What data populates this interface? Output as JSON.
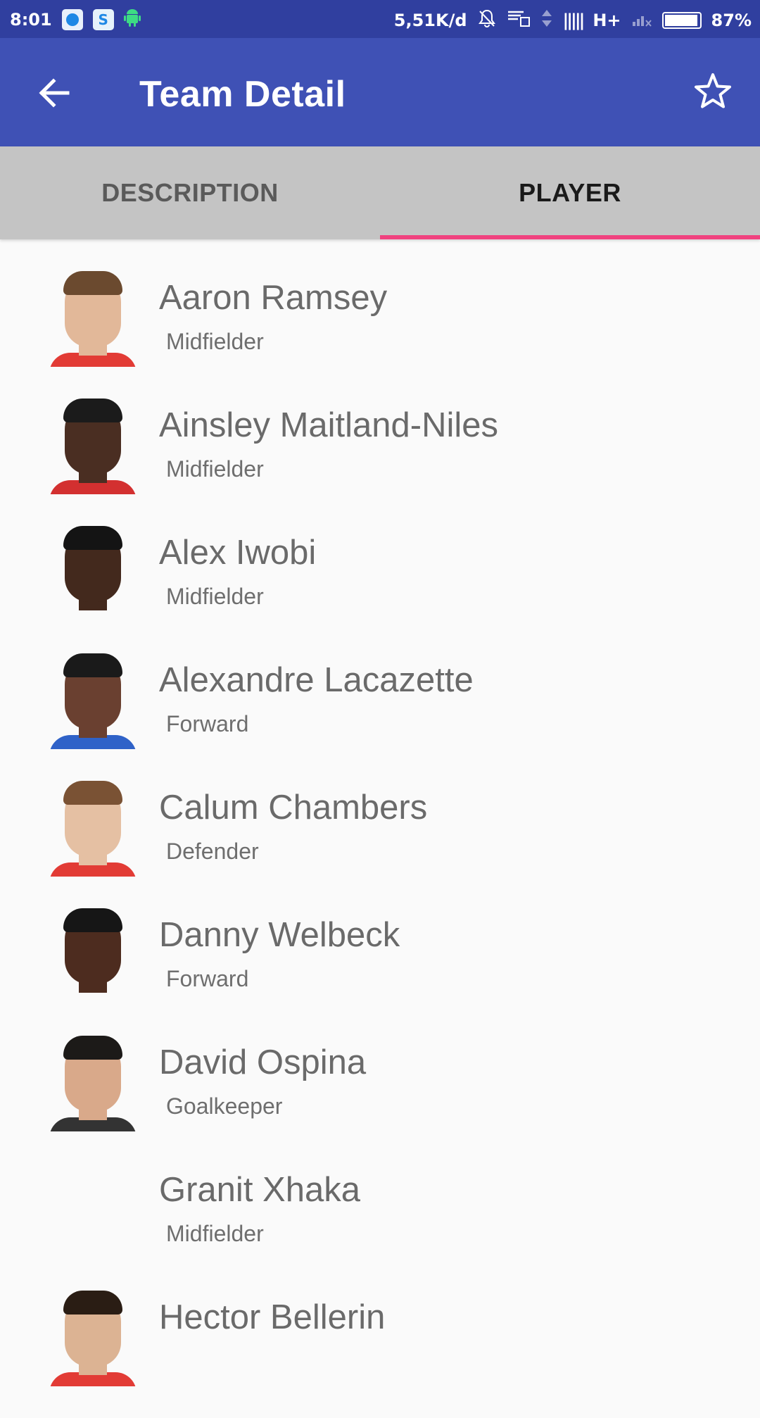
{
  "status_bar": {
    "time": "8:01",
    "net_speed": "5,51K/d",
    "network": "H+",
    "battery": "87%",
    "left_icons": [
      "browser-icon",
      "s-app-icon",
      "android-icon"
    ],
    "right_icons": [
      "notifications-off-icon",
      "wifi-icon",
      "data-arrows-icon",
      "signal-icon",
      "battery-icon"
    ]
  },
  "app_bar": {
    "title": "Team Detail",
    "back_icon": "arrow-back-icon",
    "favorite_icon": "star-outline-icon",
    "background": "#3f51b5"
  },
  "tabs": [
    {
      "label": "DESCRIPTION",
      "selected": false
    },
    {
      "label": "PLAYER",
      "selected": true
    }
  ],
  "accent_color": "#f0427f",
  "players": [
    {
      "name": "Aaron Ramsey",
      "position": "Midfielder",
      "skin": "#e2b899",
      "hair": "#6b4a2f",
      "shirt": "#e23b35"
    },
    {
      "name": "Ainsley Maitland-Niles",
      "position": "Midfielder",
      "skin": "#4a2e22",
      "hair": "#1b1b1b",
      "shirt": "#d33030"
    },
    {
      "name": "Alex Iwobi",
      "position": "Midfielder",
      "skin": "#43291d",
      "hair": "#141414",
      "shirt": "#fafafa"
    },
    {
      "name": "Alexandre Lacazette",
      "position": "Forward",
      "skin": "#6a4030",
      "hair": "#1a1a1a",
      "shirt": "#2f62c8"
    },
    {
      "name": "Calum Chambers",
      "position": "Defender",
      "skin": "#e5c0a3",
      "hair": "#7a5234",
      "shirt": "#e23b35"
    },
    {
      "name": "Danny Welbeck",
      "position": "Forward",
      "skin": "#4d2c1f",
      "hair": "#161616",
      "shirt": "#fafafa"
    },
    {
      "name": "David Ospina",
      "position": "Goalkeeper",
      "skin": "#d9a98a",
      "hair": "#1c1a18",
      "shirt": "#333333"
    },
    {
      "name": "Granit Xhaka",
      "position": "Midfielder",
      "skin": "",
      "hair": "",
      "shirt": ""
    },
    {
      "name": "Hector Bellerin",
      "position": "",
      "skin": "#dcb393",
      "hair": "#2a1d14",
      "shirt": "#e23b35"
    }
  ]
}
